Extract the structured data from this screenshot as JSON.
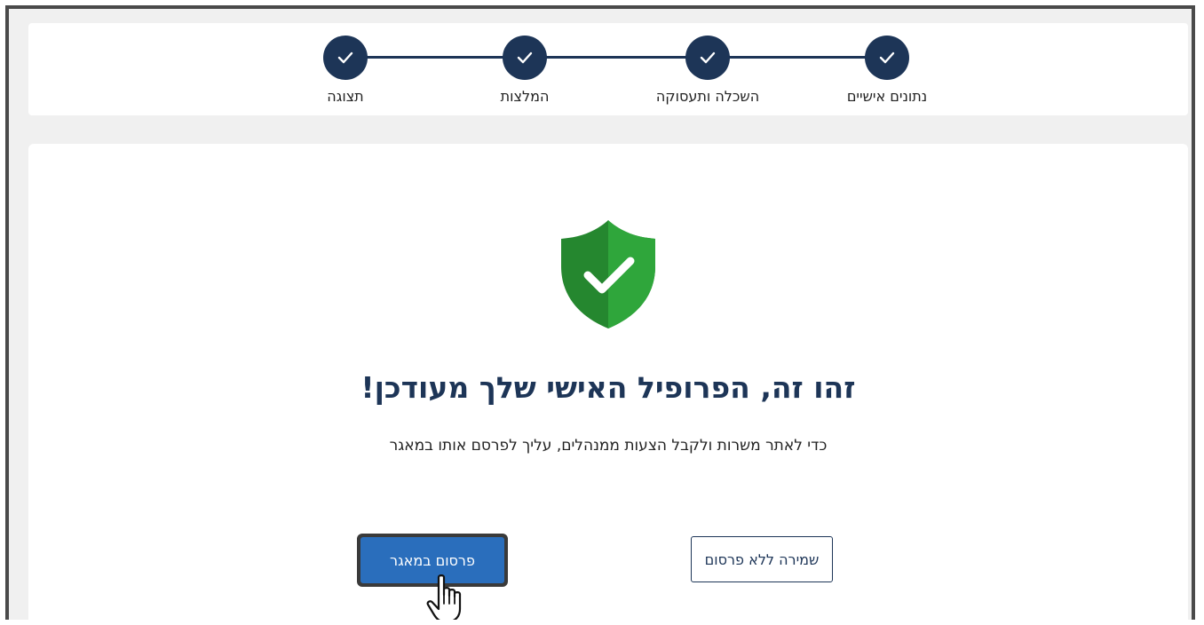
{
  "stepper": {
    "steps": [
      {
        "label": "נתונים אישיים",
        "status": "completed",
        "icon": "checkmark-icon"
      },
      {
        "label": "השכלה ותעסוקה",
        "status": "completed",
        "icon": "checkmark-icon"
      },
      {
        "label": "המלצות",
        "status": "completed",
        "icon": "checkmark-icon"
      },
      {
        "label": "תצוגה",
        "status": "completed",
        "icon": "checkmark-icon"
      }
    ],
    "color": "#1d3557"
  },
  "main": {
    "icon": "shield-check-icon",
    "icon_color": "#2e9e3a",
    "headline": "זהו זה, הפרופיל האישי שלך מעודכן!",
    "subtext": "כדי לאתר משרות ולקבל הצעות ממנהלים, עליך לפרסם אותו במאגר"
  },
  "actions": {
    "save_without_publish_label": "שמירה ללא פרסום",
    "publish_label": "פרסום במאגר",
    "publish_color": "#2a6ebc"
  },
  "cursor": {
    "icon": "hand-pointer-icon"
  }
}
